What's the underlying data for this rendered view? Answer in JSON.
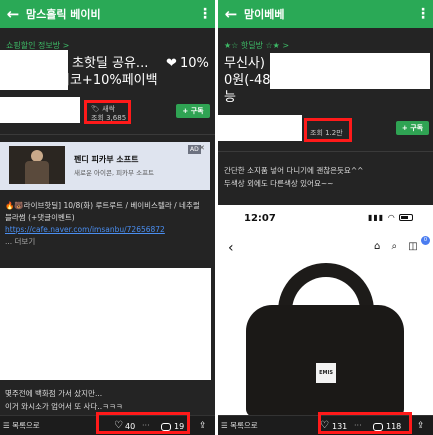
{
  "left": {
    "topbar": {
      "back_icon": "arrow-left-icon",
      "title": "맘스홀릭 베이비",
      "more_icon": "more-vertical-icon"
    },
    "category": "쇼핑할인 정보방 >",
    "title_lines": [
      "초핫딜 공유...",
      "이코+10%페이백"
    ],
    "title_tail": "10%",
    "meta": {
      "author_badge": "🏷 새싹",
      "views": "조회 3,685"
    },
    "subscribe_label": "+ 구독",
    "ad": {
      "badge": "AD",
      "close": "✕",
      "title": "펜디 피카부 소프트",
      "subtitle": "새로운 아이콘, 피카부 소프트"
    },
    "body": {
      "line1": "🔥🐻라이브핫딜] 10/8(화) 루트루트 / 베이비스텔라 / 네추럴",
      "line2": "블라썸 (+댓글이벤트)",
      "link": "https://cafe.naver.com/imsanbu/72656872",
      "more": "... 더보기",
      "bottom1": "몇주전에 백화점 가서 샀지만...",
      "bottom2": "이거 와시소가 엄어서 또 사다..ㅋㅋㅋ"
    },
    "bottombar": {
      "list_label": "☰ 목록으로",
      "likes": "40",
      "comments": "19"
    }
  },
  "right": {
    "topbar": {
      "back_icon": "arrow-left-icon",
      "title": "맘이베베",
      "more_icon": "more-vertical-icon"
    },
    "category": "★☆ 핫딜방 ☆★ >",
    "title_line1": "무신사)",
    "title_line2": "0원(-48",
    "title_line3": "능",
    "meta": {
      "views": "조회 1.2만"
    },
    "subscribe_label": "+ 구독",
    "body": {
      "line1": "간단한 소지품 넣어 다니기에 괜찮은듯요^^",
      "line2": "두색상 외에도 다른색상 있어요~~"
    },
    "screenshot": {
      "time": "12:07",
      "status": "▮▮▮ ◠",
      "nav_icons": "⌂ ⌕ ◫",
      "cart_count": "0",
      "brand": "EMIS"
    },
    "bottombar": {
      "list_label": "☰ 목록으로",
      "likes": "131",
      "comments": "118"
    }
  },
  "colors": {
    "header_green": "#2aa956",
    "accent_red": "#ff1a1a",
    "link_blue": "#4a8ef0",
    "pane_bg": "#242424"
  }
}
